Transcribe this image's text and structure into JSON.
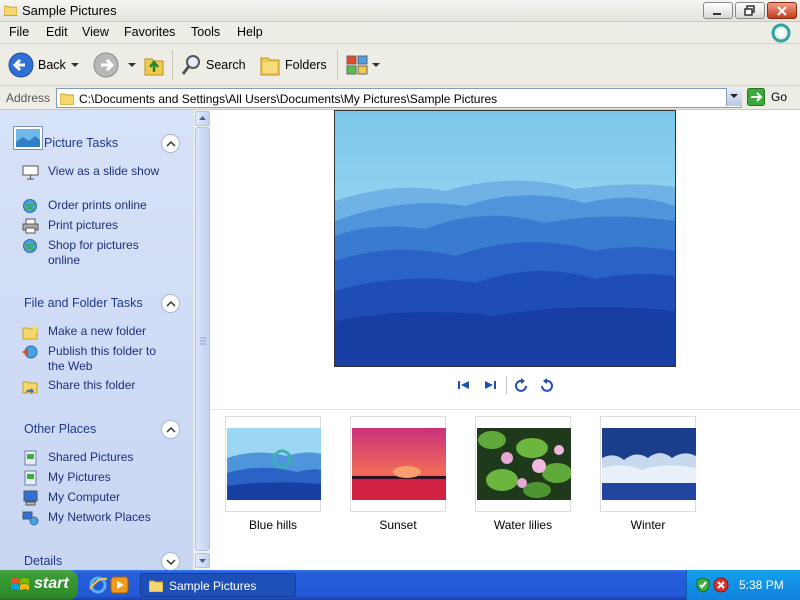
{
  "window": {
    "title": "Sample Pictures"
  },
  "menu": {
    "items": [
      "File",
      "Edit",
      "View",
      "Favorites",
      "Tools",
      "Help"
    ]
  },
  "toolbar": {
    "back_label": "Back",
    "search_label": "Search",
    "folders_label": "Folders"
  },
  "address": {
    "label": "Address",
    "path": "C:\\Documents and Settings\\All Users\\Documents\\My Pictures\\Sample Pictures",
    "go_label": "Go"
  },
  "taskpane": {
    "picture_tasks": {
      "title": "Picture Tasks",
      "items": [
        "View as a slide show",
        "Order prints online",
        "Print pictures",
        "Shop for pictures online"
      ]
    },
    "file_folder_tasks": {
      "title": "File and Folder Tasks",
      "items": [
        "Make a new folder",
        "Publish this folder to the Web",
        "Share this folder"
      ]
    },
    "other_places": {
      "title": "Other Places",
      "items": [
        "Shared Pictures",
        "My Pictures",
        "My Computer",
        "My Network Places"
      ]
    },
    "details": {
      "title": "Details"
    }
  },
  "thumbnails": [
    {
      "label": "Blue hills"
    },
    {
      "label": "Sunset"
    },
    {
      "label": "Water lilies"
    },
    {
      "label": "Winter"
    }
  ],
  "taskbar": {
    "start_label": "start",
    "task_button_label": "Sample Pictures",
    "clock": "5:38 PM"
  },
  "colors": {
    "link_text": "#1c2f7a",
    "section_title": "#1e3a8c",
    "taskbar_blue": "#245edb",
    "start_green": "#389c33"
  }
}
